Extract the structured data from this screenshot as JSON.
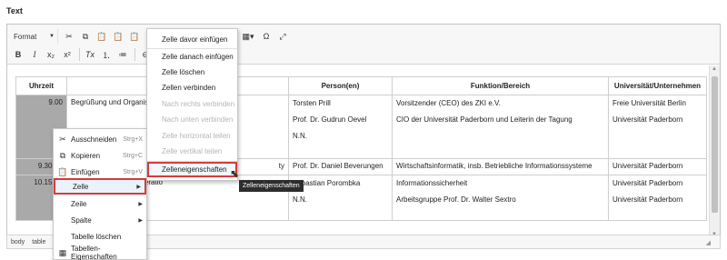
{
  "field_label": "Text",
  "toolbar": {
    "format_label": "Format",
    "row1_icons": [
      "cut-icon",
      "copy-icon",
      "paste-icon",
      "paste-text-icon",
      "paste-word-icon"
    ],
    "row2_icons": [
      "bold-icon",
      "italic-icon",
      "subscript-icon",
      "superscript-icon",
      "clear-format-icon",
      "numbered-list-icon",
      "bulleted-list-icon",
      "anchor-icon"
    ],
    "row1_right_icons": [
      "table-icon",
      "omega-icon",
      "maximize-icon"
    ]
  },
  "table": {
    "headers": [
      "Uhrzeit",
      "",
      "Person(en)",
      "Funktion/Bereich",
      "Universität/Unternehmen"
    ],
    "rows": [
      {
        "time": "9.00",
        "topic": "Begrüßung und Organisa",
        "persons": [
          "Torsten Prill",
          "Prof. Dr. Gudrun Oevel",
          "N.N."
        ],
        "functions": [
          "Vorsitzender (CEO) des ZKI e.V.",
          "CIO der Universität Paderborn und Leiterin der Tagung",
          ""
        ],
        "orgs": [
          "Freie Universität Berlin",
          "Universität Paderborn",
          ""
        ]
      },
      {
        "time": "9.30 - 1",
        "topic": "ty",
        "persons": [
          "Prof. Dr. Daniel Beverungen"
        ],
        "functions": [
          "Wirtschaftsinformatik, insb. Betriebliche Informationssysteme"
        ],
        "orgs": [
          "Universität Paderborn"
        ]
      },
      {
        "time": "10.15 - 1",
        "topic": "ertifizierung - Ein Kooperatio",
        "persons": [
          "Sebastian Porombka",
          "N.N."
        ],
        "functions": [
          "Informationssicherheit",
          "Arbeitsgruppe Prof. Dr. Walter Sextro"
        ],
        "orgs": [
          "Universität Paderborn",
          "Universität Paderborn"
        ]
      }
    ]
  },
  "statusbar": {
    "path": [
      "body",
      "table"
    ]
  },
  "context_menu": {
    "items": [
      {
        "label": "Ausschneiden",
        "shortcut": "Strg+X",
        "icon": "cut-icon"
      },
      {
        "label": "Kopieren",
        "shortcut": "Strg+C",
        "icon": "copy-icon"
      },
      {
        "label": "Einfügen",
        "shortcut": "Strg+V",
        "icon": "paste-icon"
      },
      {
        "label": "Zelle",
        "shortcut": "",
        "icon": "",
        "submenu": true,
        "active": true
      },
      {
        "label": "Zeile",
        "shortcut": "",
        "icon": "",
        "submenu": true
      },
      {
        "label": "Spalte",
        "shortcut": "",
        "icon": "",
        "submenu": true
      },
      {
        "label": "Tabelle löschen",
        "shortcut": "",
        "icon": ""
      },
      {
        "label": "Tabellen-Eigenschaften",
        "shortcut": "",
        "icon": "table-icon"
      }
    ]
  },
  "cell_submenu": {
    "items": [
      {
        "label": "Zelle davor einfügen",
        "disabled": false
      },
      {
        "label": "Zelle danach einfügen",
        "disabled": false
      },
      {
        "label": "Zelle löschen",
        "disabled": false
      },
      {
        "label": "Zellen verbinden",
        "disabled": false
      },
      {
        "label": "Nach rechts verbinden",
        "disabled": true
      },
      {
        "label": "Nach unten verbinden",
        "disabled": true
      },
      {
        "label": "Zelle horizontal teilen",
        "disabled": true
      },
      {
        "label": "Zelle vertikal teilen",
        "disabled": true
      },
      {
        "label": "Zelleneigenschaften",
        "disabled": false,
        "active": true
      }
    ]
  },
  "tooltip": "Zelleneigenschaften",
  "colors": {
    "highlight_border": "#d63b3b",
    "time_cell_bg": "#a9a9a9",
    "tooltip_bg": "#2d2d2d"
  }
}
